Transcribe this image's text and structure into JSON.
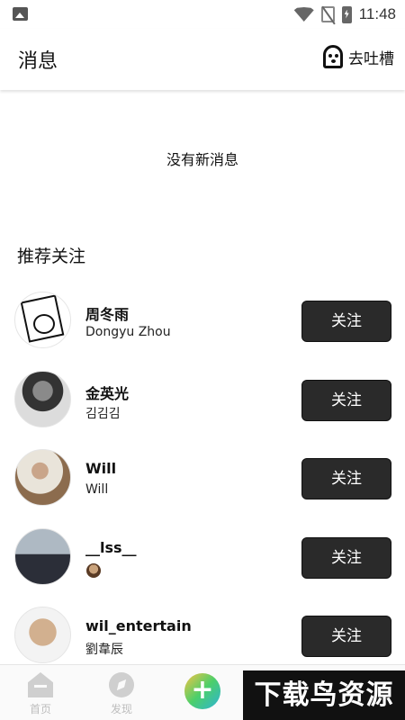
{
  "status_bar": {
    "time": "11:48"
  },
  "header": {
    "title": "消息",
    "action_label": "去吐槽"
  },
  "empty_message": "没有新消息",
  "recommend": {
    "section_title": "推荐关注",
    "follow_label": "关注",
    "users": [
      {
        "name": "周冬雨",
        "subtitle": "Dongyu Zhou"
      },
      {
        "name": "金英光",
        "subtitle": "김김김"
      },
      {
        "name": "Will",
        "subtitle": "Will"
      },
      {
        "name": "__lss__",
        "subtitle": ""
      },
      {
        "name": "wil_entertain",
        "subtitle": "劉韋辰"
      }
    ]
  },
  "tabbar": {
    "home_label": "首页",
    "discover_label": "发现",
    "add_label": "+"
  },
  "watermark": "下载鸟资源"
}
